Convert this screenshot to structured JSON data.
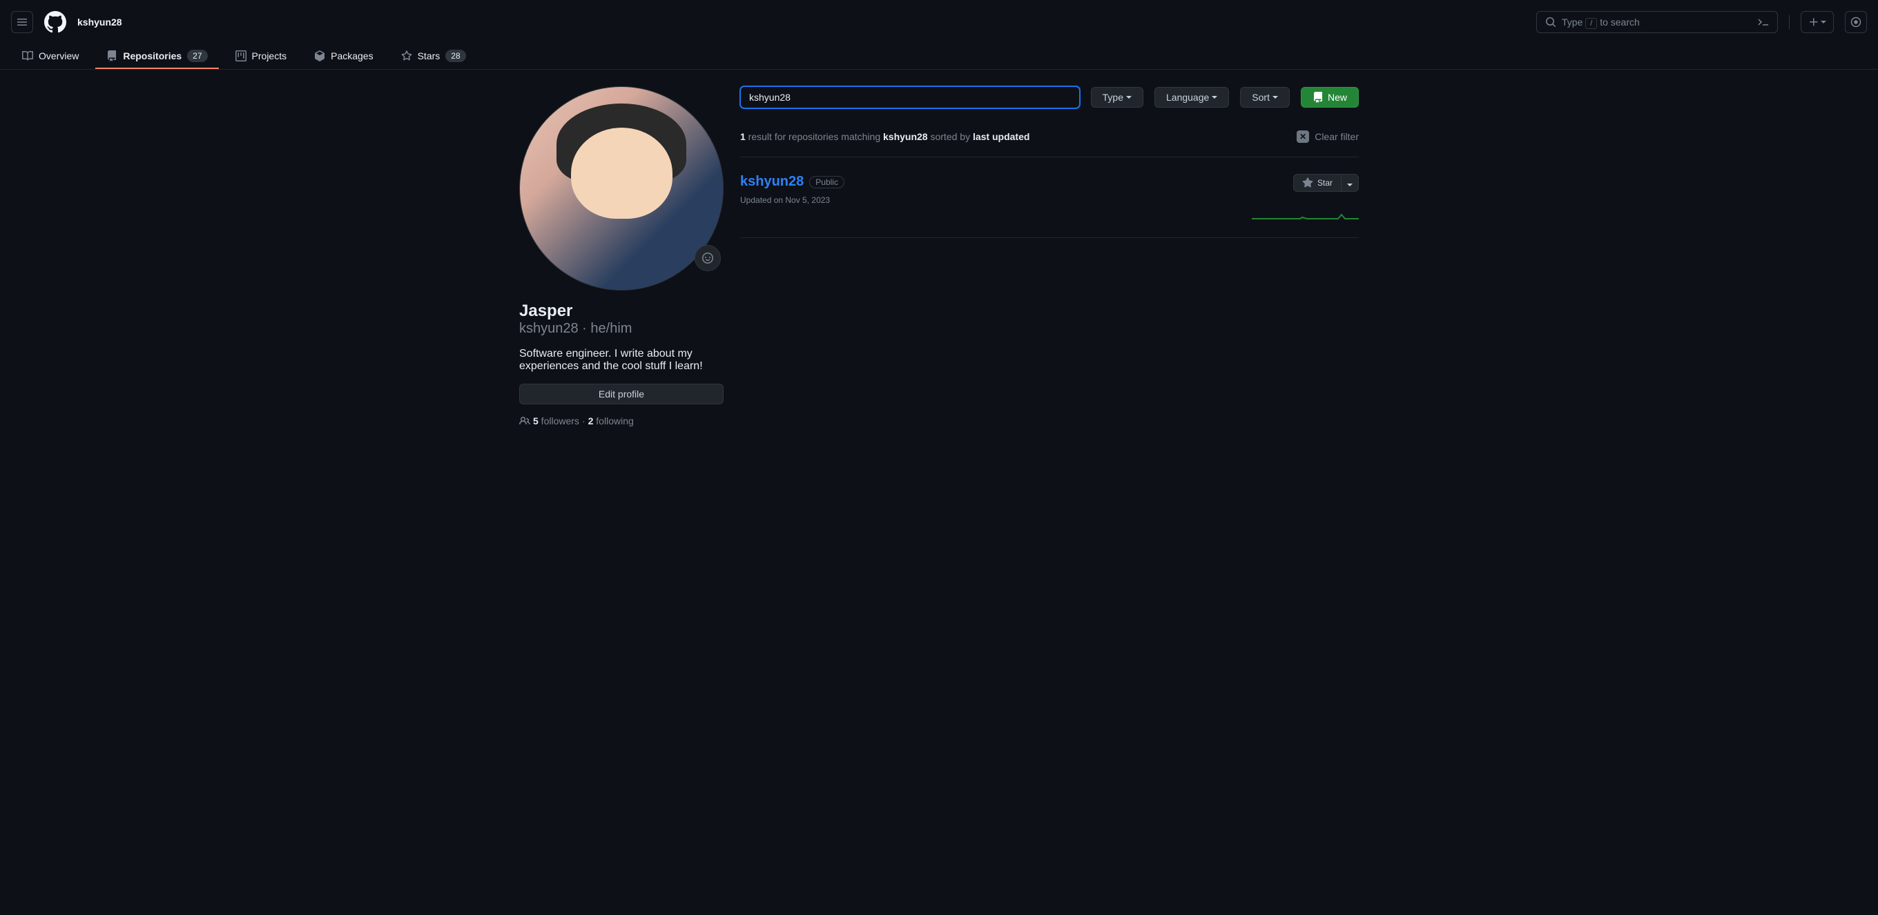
{
  "header": {
    "username": "kshyun28",
    "search_placeholder": "Type",
    "search_hint": "to search",
    "slash_key": "/"
  },
  "nav": {
    "overview": "Overview",
    "repositories": "Repositories",
    "repositories_count": "27",
    "projects": "Projects",
    "packages": "Packages",
    "stars": "Stars",
    "stars_count": "28"
  },
  "profile": {
    "display_name": "Jasper",
    "username": "kshyun28",
    "pronouns": "he/him",
    "separator": " · ",
    "bio": "Software engineer. I write about my experiences and the cool stuff I learn!",
    "edit_button": "Edit profile",
    "followers_count": "5",
    "followers_label": " followers",
    "stat_separator": " · ",
    "following_count": "2",
    "following_label": " following"
  },
  "filters": {
    "search_value": "kshyun28",
    "type_label": "Type",
    "language_label": "Language",
    "sort_label": "Sort",
    "new_label": "New"
  },
  "results": {
    "count": "1",
    "text_prefix": " result for repositories matching ",
    "query": "kshyun28",
    "text_middle": " sorted by ",
    "sort_by": "last updated",
    "clear_label": "Clear filter"
  },
  "repo": {
    "name": "kshyun28",
    "visibility": "Public",
    "updated": "Updated on Nov 5, 2023",
    "star_label": "Star"
  }
}
